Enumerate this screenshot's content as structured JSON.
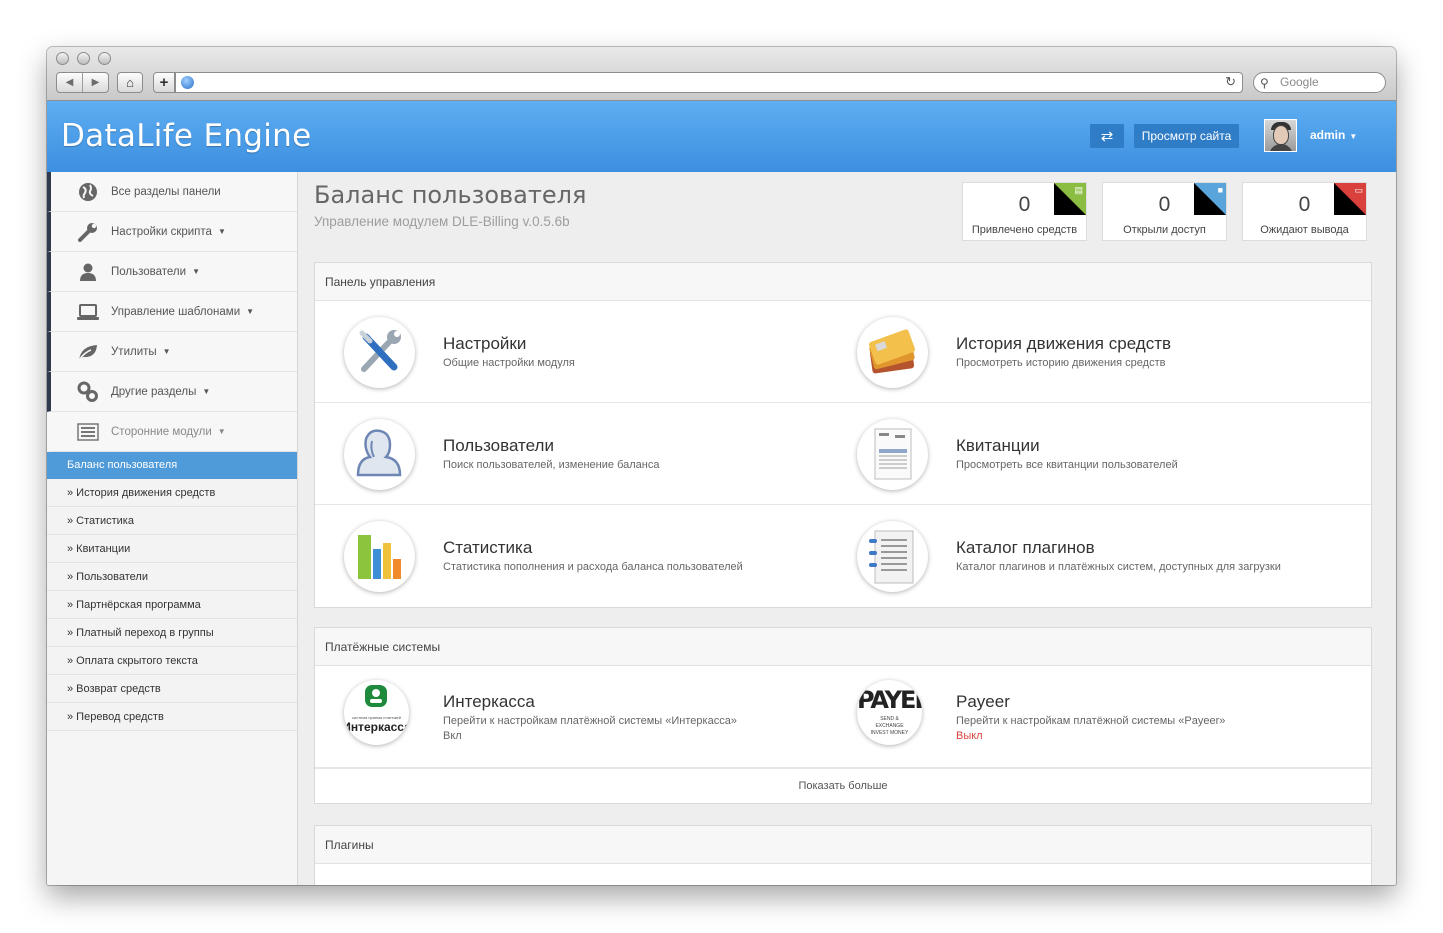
{
  "browser": {
    "search_placeholder": "Google"
  },
  "header": {
    "brand": "DataLife Engine",
    "switch_icon": "⇄",
    "view_site": "Просмотр сайта",
    "admin": "admin"
  },
  "sidebar": {
    "items": [
      {
        "label": "Все разделы панели",
        "icon": "globe-icon",
        "caret": false
      },
      {
        "label": "Настройки скрипта",
        "icon": "wrench-icon",
        "caret": true
      },
      {
        "label": "Пользователи",
        "icon": "user-icon",
        "caret": true
      },
      {
        "label": "Управление шаблонами",
        "icon": "laptop-icon",
        "caret": true
      },
      {
        "label": "Утилиты",
        "icon": "leaf-icon",
        "caret": true
      },
      {
        "label": "Другие разделы",
        "icon": "gears-icon",
        "caret": true
      },
      {
        "label": "Сторонние модули",
        "icon": "list-icon",
        "caret": true
      }
    ],
    "active": "Баланс пользователя",
    "sub": [
      "» История движения средств",
      "» Статистика",
      "» Квитанции",
      "» Пользователи",
      "» Партнёрская программа",
      "» Платный переход в группы",
      "» Оплата скрытого текста",
      "» Возврат средств",
      "» Перевод средств"
    ]
  },
  "page": {
    "title": "Баланс пользователя",
    "subtitle": "Управление модулем DLE-Billing v.0.5.6b"
  },
  "stats": [
    {
      "value": "0",
      "label": "Привлечено средств",
      "color": "#8bbd43"
    },
    {
      "value": "0",
      "label": "Открыли доступ",
      "color": "#5aa4dc"
    },
    {
      "value": "0",
      "label": "Ожидают вывода",
      "color": "#d9423c"
    }
  ],
  "control_panel": {
    "title": "Панель управления",
    "items": [
      {
        "title": "Настройки",
        "desc": "Общие настройки модуля",
        "icon": "tools-icon"
      },
      {
        "title": "История движения средств",
        "desc": "Просмотреть историю движения средств",
        "icon": "cards-icon"
      },
      {
        "title": "Пользователи",
        "desc": "Поиск пользователей, изменение баланса",
        "icon": "users-icon"
      },
      {
        "title": "Квитанции",
        "desc": "Просмотреть все квитанции пользователей",
        "icon": "invoice-icon"
      },
      {
        "title": "Статистика",
        "desc": "Статистика пополнения и расхода баланса пользователей",
        "icon": "bar-chart-icon"
      },
      {
        "title": "Каталог плагинов",
        "desc": "Каталог плагинов и платёжных систем, доступных для загрузки",
        "icon": "catalog-icon"
      }
    ]
  },
  "payment_systems": {
    "title": "Платёжные системы",
    "items": [
      {
        "title": "Интеркасса",
        "desc": "Перейти к настройкам платёжной системы «Интеркасса»",
        "status": "Вкл",
        "status_color": "#666666",
        "logo_text": "Интеркасса",
        "logo_small": "система приема платежей"
      },
      {
        "title": "Payeer",
        "desc": "Перейти к настройкам платёжной системы «Payeer»",
        "status": "Выкл",
        "status_color": "#d9423c",
        "logo_text": "PAYEER",
        "logo_small": "SEND & EXCHANGE INVEST MONEY"
      }
    ],
    "more": "Показать больше"
  },
  "plugins": {
    "title": "Плагины"
  }
}
